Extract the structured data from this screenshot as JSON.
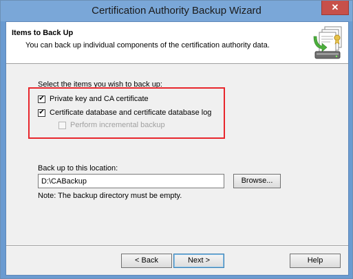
{
  "window": {
    "title": "Certification Authority Backup Wizard",
    "close_glyph": "✕"
  },
  "header": {
    "title": "Items to Back Up",
    "subtitle": "You can back up individual components of the certification authority data."
  },
  "main": {
    "instruction": "Select the items you wish to back up:",
    "checkboxes": [
      {
        "label": "Private key and CA certificate",
        "checked": true,
        "enabled": true
      },
      {
        "label": "Certificate database and certificate database log",
        "checked": true,
        "enabled": true
      },
      {
        "label": "Perform incremental backup",
        "checked": false,
        "enabled": false
      }
    ],
    "location_label": "Back up to this location:",
    "location_value": "D:\\CABackup",
    "browse_label": "Browse...",
    "note": "Note: The backup directory must be empty."
  },
  "footer": {
    "back_label": "< Back",
    "next_label": "Next >",
    "help_label": "Help"
  },
  "colors": {
    "highlight": "#e8252b",
    "titlebar": "#7aa7d8"
  },
  "icons": {
    "wizard": "ca-backup-wizard-icon",
    "check": "checkmark-icon"
  }
}
